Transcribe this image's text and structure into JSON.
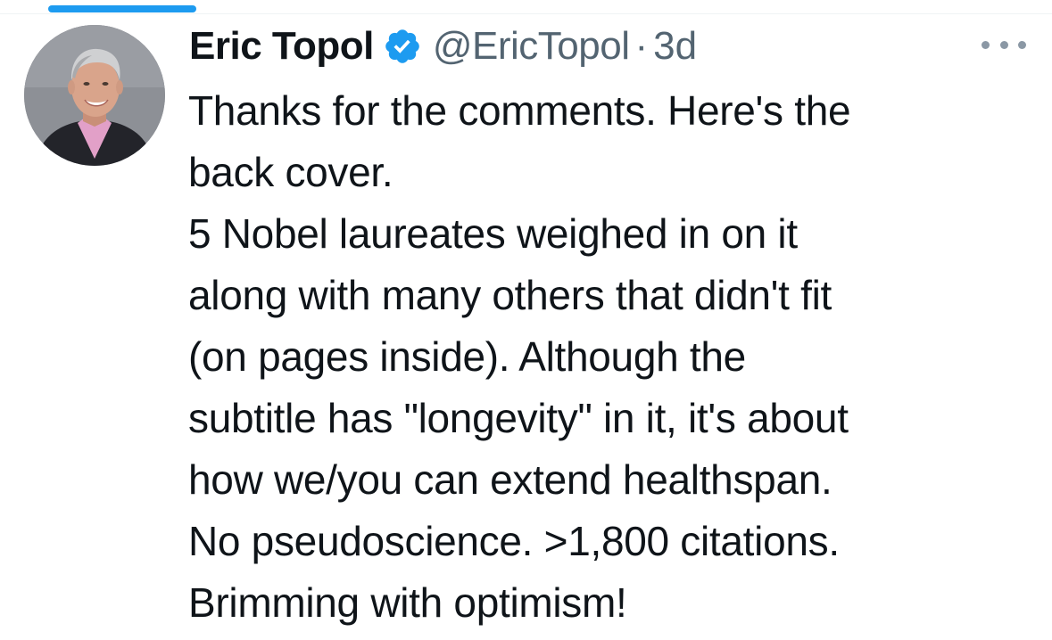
{
  "author": {
    "display_name": "Eric Topol",
    "handle": "@EricTopol",
    "separator": "·",
    "time_ago": "3d",
    "verified": true,
    "verified_color": "#1d9bf0"
  },
  "tweet": {
    "lines": [
      "Thanks for the comments. Here's the",
      "back cover.",
      "5 Nobel laureates weighed in on it",
      "along with many others that didn't fit",
      "(on pages inside). Although the",
      "subtitle has \"longevity\" in it, it's about",
      "how we/you can extend healthspan.",
      "No pseudoscience.  >1,800 citations.",
      "Brimming with optimism!"
    ]
  },
  "icons": {
    "verified": "verified-badge-icon",
    "more": "more-options-icon"
  },
  "colors": {
    "accent": "#1d9bf0",
    "text_primary": "#0f1419",
    "text_secondary": "#536471"
  }
}
